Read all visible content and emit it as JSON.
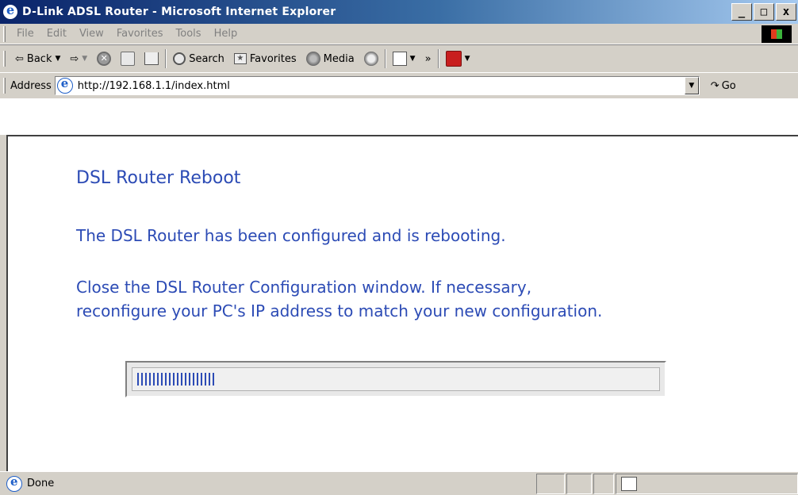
{
  "window": {
    "title": "D-Link ADSL Router - Microsoft Internet Explorer",
    "minimize_glyph": "_",
    "maximize_glyph": "□",
    "close_glyph": "x"
  },
  "menu": {
    "items": [
      "File",
      "Edit",
      "View",
      "Favorites",
      "Tools",
      "Help"
    ]
  },
  "toolbar": {
    "back_label": "Back",
    "search_label": "Search",
    "favorites_label": "Favorites",
    "media_label": "Media",
    "chevron": "»"
  },
  "address": {
    "label": "Address",
    "url": "http://192.168.1.1/index.html",
    "go_label": "Go"
  },
  "page": {
    "heading": "DSL Router Reboot",
    "message_1": "The DSL Router has been configured and is rebooting.",
    "message_2_line1": "Close the DSL Router Configuration window. If necessary,",
    "message_2_line2": "reconfigure your PC's IP address to match your new configuration.",
    "progress_fraction": 0.15,
    "accent_color": "#2c4bb5"
  },
  "status": {
    "text": "Done"
  }
}
